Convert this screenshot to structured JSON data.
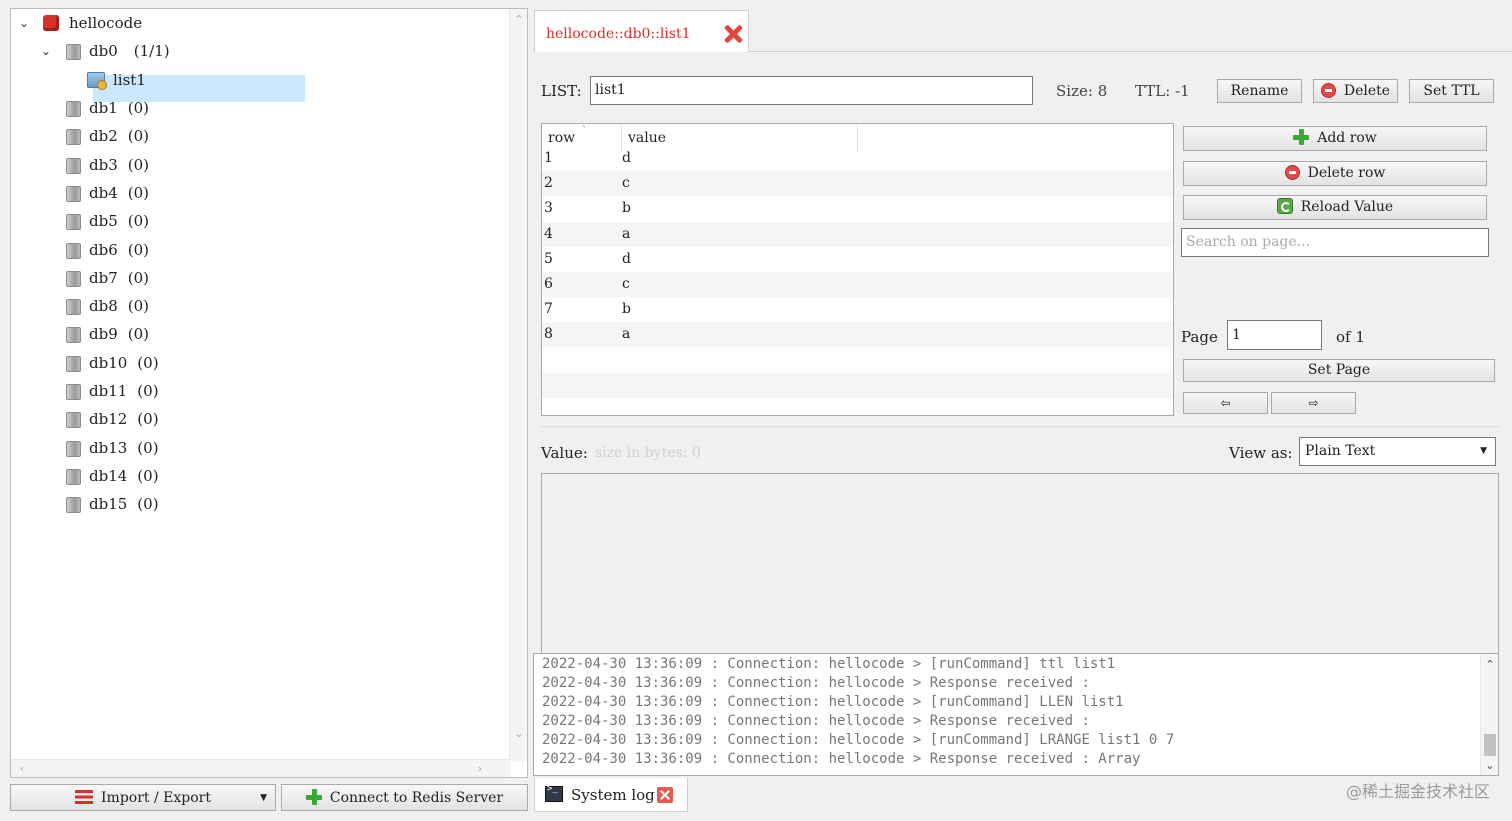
{
  "tree": {
    "server": "hellocode",
    "db0": {
      "name": "db0",
      "count": "(1/1)"
    },
    "selected_key": "list1",
    "databases": [
      {
        "name": "db1",
        "count": "(0)"
      },
      {
        "name": "db2",
        "count": "(0)"
      },
      {
        "name": "db3",
        "count": "(0)"
      },
      {
        "name": "db4",
        "count": "(0)"
      },
      {
        "name": "db5",
        "count": "(0)"
      },
      {
        "name": "db6",
        "count": "(0)"
      },
      {
        "name": "db7",
        "count": "(0)"
      },
      {
        "name": "db8",
        "count": "(0)"
      },
      {
        "name": "db9",
        "count": "(0)"
      },
      {
        "name": "db10",
        "count": "(0)"
      },
      {
        "name": "db11",
        "count": "(0)"
      },
      {
        "name": "db12",
        "count": "(0)"
      },
      {
        "name": "db13",
        "count": "(0)"
      },
      {
        "name": "db14",
        "count": "(0)"
      },
      {
        "name": "db15",
        "count": "(0)"
      }
    ]
  },
  "left_buttons": {
    "import_export": "Import / Export",
    "connect": "Connect to Redis Server"
  },
  "tab": {
    "title": "hellocode::db0::list1"
  },
  "key_header": {
    "type_label": "LIST:",
    "key_name": "list1",
    "size_label": "Size:",
    "size_value": "8",
    "ttl_label": "TTL:",
    "ttl_value": "-1",
    "rename": "Rename",
    "delete": "Delete",
    "set_ttl": "Set TTL"
  },
  "table": {
    "columns": [
      "row",
      "value"
    ],
    "rows": [
      {
        "row": "1",
        "value": "d"
      },
      {
        "row": "2",
        "value": "c"
      },
      {
        "row": "3",
        "value": "b"
      },
      {
        "row": "4",
        "value": "a"
      },
      {
        "row": "5",
        "value": "d"
      },
      {
        "row": "6",
        "value": "c"
      },
      {
        "row": "7",
        "value": "b"
      },
      {
        "row": "8",
        "value": "a"
      }
    ]
  },
  "side_actions": {
    "add_row": "Add row",
    "delete_row": "Delete row",
    "reload_value": "Reload Value",
    "search_placeholder": "Search on page...",
    "page_label": "Page",
    "page_value": "1",
    "of_label": "of 1",
    "set_page": "Set Page",
    "prev": "⇦",
    "next": "⇨"
  },
  "value_section": {
    "label": "Value:",
    "size_hint": "size in bytes: 0",
    "view_as_label": "View as:",
    "view_as_value": "Plain Text"
  },
  "log": {
    "lines": [
      "2022-04-30 13:36:09 : Connection: hellocode > [runCommand] ttl list1",
      "2022-04-30 13:36:09 : Connection: hellocode > Response received :",
      "2022-04-30 13:36:09 : Connection: hellocode > [runCommand] LLEN list1",
      "2022-04-30 13:36:09 : Connection: hellocode > Response received :",
      "2022-04-30 13:36:09 : Connection: hellocode > [runCommand] LRANGE list1 0 7",
      "2022-04-30 13:36:09 : Connection: hellocode > Response received : Array"
    ]
  },
  "bottom_tab": {
    "label": "System log"
  },
  "watermark": "@稀土掘金技术社区",
  "colors": {
    "accent": "#d8302a",
    "selection": "#cce8ff"
  }
}
